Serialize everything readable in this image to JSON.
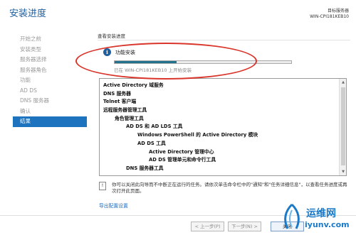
{
  "header": {
    "title": "安装进度",
    "server_label": "目标服务器",
    "server_name": "WIN-CPI181KEB10"
  },
  "sidebar": {
    "items": [
      {
        "label": "开始之前",
        "active": false
      },
      {
        "label": "安装类型",
        "active": false
      },
      {
        "label": "服务器选择",
        "active": false
      },
      {
        "label": "服务器角色",
        "active": false
      },
      {
        "label": "功能",
        "active": false
      },
      {
        "label": "AD DS",
        "active": false
      },
      {
        "label": "DNS 服务器",
        "active": false
      },
      {
        "label": "确认",
        "active": false
      },
      {
        "label": "结果",
        "active": true
      }
    ]
  },
  "main": {
    "section_label": "查看安装进度",
    "progress": {
      "label": "功能安装",
      "value": 0.35,
      "status": "已在 WIN-CPI181KEB10 上开始安装",
      "fill_color": "#23738e"
    },
    "features": [
      {
        "label": "Active Directory 域服务",
        "level": 0
      },
      {
        "label": "DNS 服务器",
        "level": 0
      },
      {
        "label": "Telnet 客户端",
        "level": 0
      },
      {
        "label": "远程服务器管理工具",
        "level": 0
      },
      {
        "label": "角色管理工具",
        "level": 1
      },
      {
        "label": "AD DS 和 AD LDS 工具",
        "level": 2
      },
      {
        "label": "Windows PowerShell 的 Active Directory 模块",
        "level": 3
      },
      {
        "label": "AD DS 工具",
        "level": 3
      },
      {
        "label": "Active Directory 管理中心",
        "level": 4
      },
      {
        "label": "AD DS 管理单元和命令行工具",
        "level": 4
      },
      {
        "label": "DNS 服务器工具",
        "level": 2
      }
    ],
    "note": "你可以关闭此向导而不中断正在运行的任务。请依次单击命令栏中的\"通知\"和\"任务详细信息\"，以查看任务进度或再次打开此页面。",
    "export_link": "导出配置设置"
  },
  "footer": {
    "prev_label": "< 上一步(P)",
    "next_label": "下一步(N) >",
    "close_label": "关闭"
  },
  "watermark": {
    "brand": "运维网",
    "url": "iyunv.com"
  },
  "colors": {
    "title": "#1f5f9e",
    "nav_active": "#1e73be",
    "annotation": "#d9352b"
  }
}
